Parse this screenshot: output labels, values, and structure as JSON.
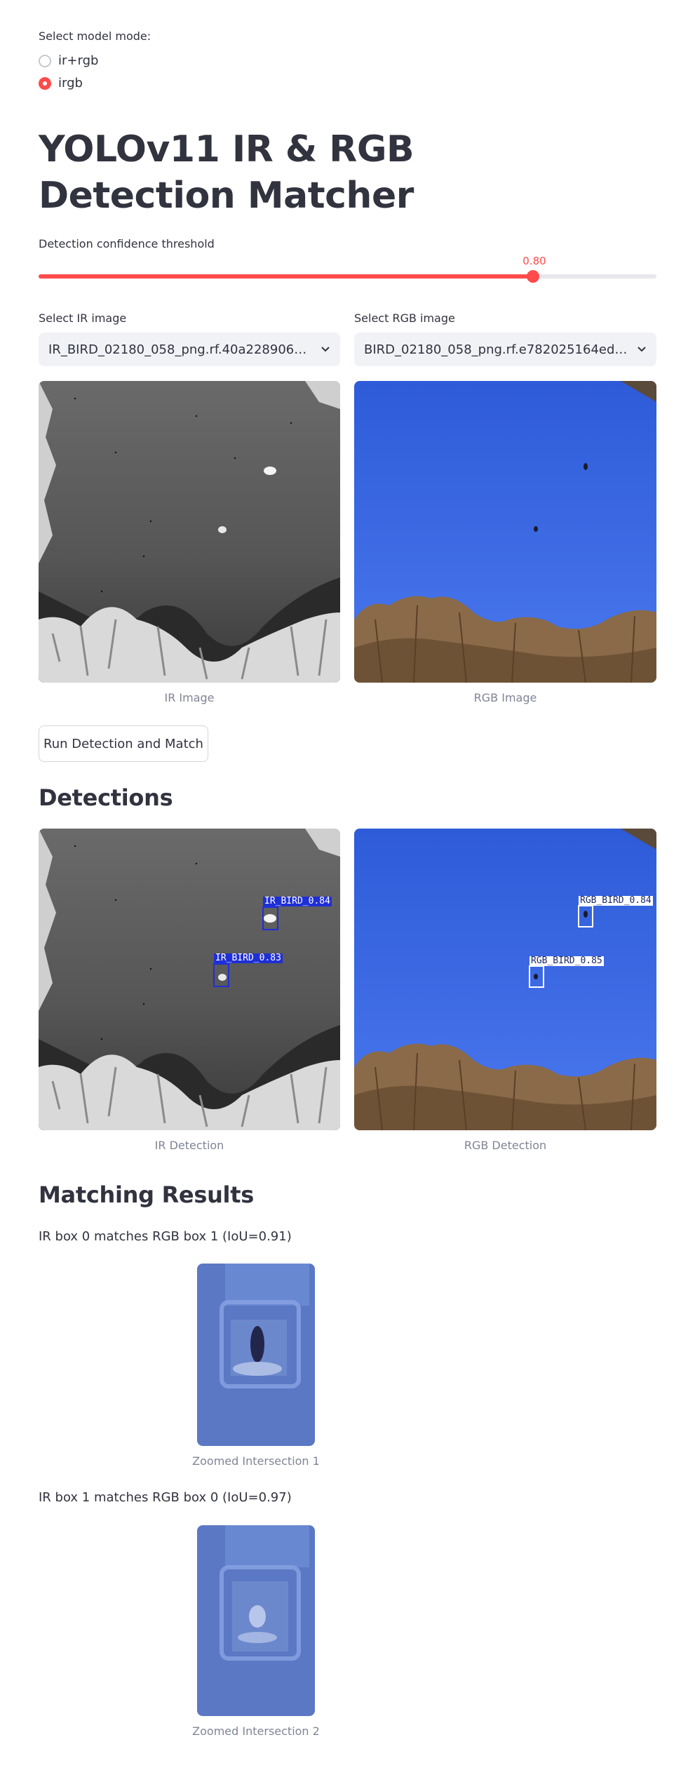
{
  "mode": {
    "label": "Select model mode:",
    "options": [
      {
        "label": "ir+rgb",
        "selected": false
      },
      {
        "label": "irgb",
        "selected": true
      }
    ]
  },
  "title": "YOLOv11 IR & RGB Detection Matcher",
  "threshold": {
    "label": "Detection confidence threshold",
    "value": "0.80",
    "fraction": 0.8,
    "color": "#ff4b4b"
  },
  "ir_select": {
    "label": "Select IR image",
    "value": "IR_BIRD_02180_058_png.rf.40a2289066..."
  },
  "rgb_select": {
    "label": "Select RGB image",
    "value": "BIRD_02180_058_png.rf.e782025164edb..."
  },
  "images": {
    "ir_caption": "IR Image",
    "rgb_caption": "RGB Image"
  },
  "run_button": "Run Detection and Match",
  "detections": {
    "heading": "Detections",
    "ir_caption": "IR Detection",
    "rgb_caption": "RGB Detection",
    "ir_boxes": [
      "IR_BIRD_0.84",
      "IR_BIRD_0.83"
    ],
    "rgb_boxes": [
      "RGB_BIRD_0.84",
      "RGB_BIRD_0.85"
    ]
  },
  "matching": {
    "heading": "Matching Results",
    "results": [
      {
        "text": "IR box 0 matches RGB box 1 (IoU=0.91)",
        "caption": "Zoomed Intersection 1"
      },
      {
        "text": "IR box 1 matches RGB box 0 (IoU=0.97)",
        "caption": "Zoomed Intersection 2"
      }
    ]
  },
  "colors": {
    "accent": "#ff4b4b",
    "text": "#31333f",
    "caption": "#808495",
    "select_bg": "#f0f2f6",
    "ir_box": "#1f2fd6",
    "rgb_box": "#ffffff"
  }
}
